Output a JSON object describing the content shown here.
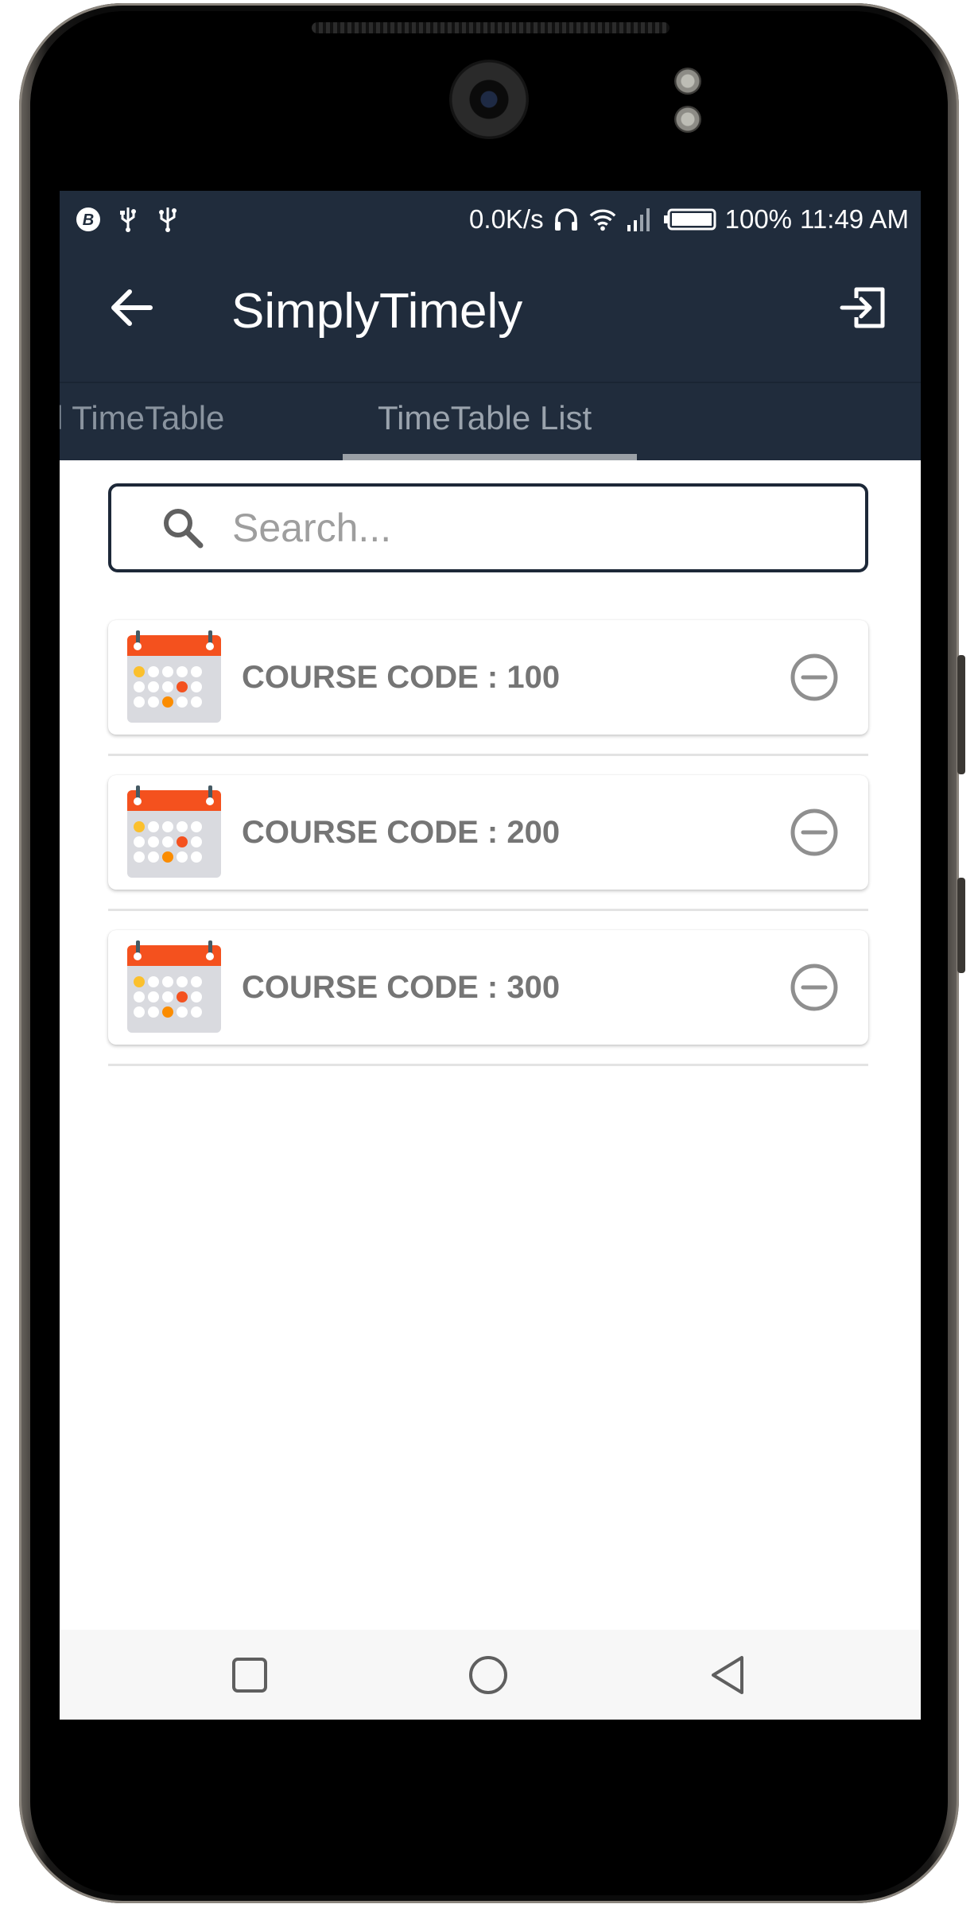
{
  "status_bar": {
    "network_speed": "0.0K/s",
    "battery_percent": "100%",
    "time": "11:49 AM",
    "left_icons": [
      "b-circle-icon",
      "usb-icon",
      "usb-debug-icon"
    ],
    "right_icons": [
      "headphones-icon",
      "wifi-icon",
      "signal-icon",
      "battery-icon"
    ]
  },
  "app_bar": {
    "title": "SimplyTimely",
    "back_icon": "arrow-left-icon",
    "exit_icon": "exit-to-app-icon"
  },
  "tabs": [
    {
      "label": "l TimeTable",
      "selected": false
    },
    {
      "label": "TimeTable List",
      "selected": true
    }
  ],
  "search": {
    "placeholder": "Search...",
    "value": ""
  },
  "courses": [
    {
      "label": "COURSE CODE : 100"
    },
    {
      "label": "COURSE CODE : 200"
    },
    {
      "label": "COURSE CODE : 300"
    }
  ],
  "colors": {
    "app_bar": "#202c3c",
    "calendar_header": "#f4511e",
    "course_text": "#757575",
    "tab_text": "#8a949f"
  },
  "nav_bar": {
    "icons": [
      "recents-square-icon",
      "home-circle-icon",
      "back-triangle-icon"
    ]
  }
}
